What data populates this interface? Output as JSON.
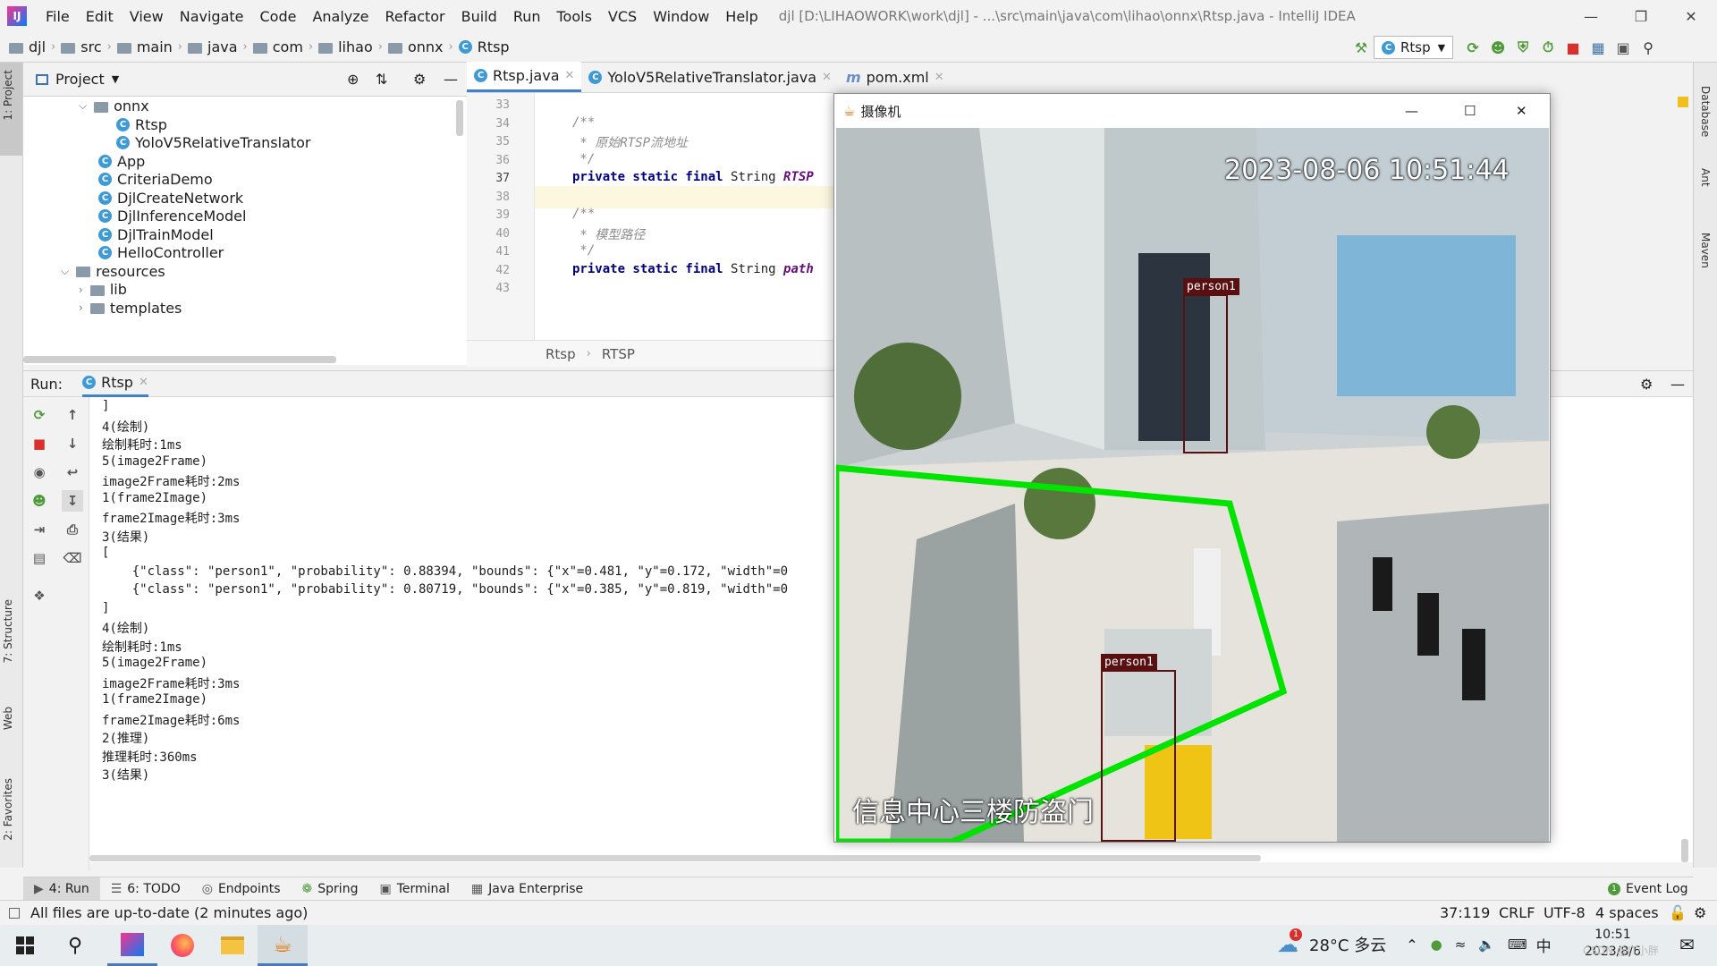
{
  "app": {
    "logo": "IJ",
    "title": "djl [D:\\LIHAOWORK\\work\\djl] - ...\\src\\main\\java\\com\\lihao\\onnx\\Rtsp.java - IntelliJ IDEA"
  },
  "menu": [
    "File",
    "Edit",
    "View",
    "Navigate",
    "Code",
    "Analyze",
    "Refactor",
    "Build",
    "Run",
    "Tools",
    "VCS",
    "Window",
    "Help"
  ],
  "breadcrumbs": [
    "djl",
    "src",
    "main",
    "java",
    "com",
    "lihao",
    "onnx",
    "Rtsp"
  ],
  "run_config": "Rtsp",
  "left_strip": {
    "project": "1: Project",
    "structure": "7: Structure",
    "web": "Web",
    "favorites": "2: Favorites"
  },
  "right_strip": {
    "database": "Database",
    "ant": "Ant",
    "maven": "Maven"
  },
  "project_panel": {
    "title": "Project",
    "tree": [
      {
        "label": "onnx",
        "kind": "folder",
        "indent": 3,
        "expanded": true
      },
      {
        "label": "Rtsp",
        "kind": "class",
        "indent": 5
      },
      {
        "label": "YoloV5RelativeTranslator",
        "kind": "class",
        "indent": 5
      },
      {
        "label": "App",
        "kind": "class",
        "indent": 4
      },
      {
        "label": "CriteriaDemo",
        "kind": "class",
        "indent": 4
      },
      {
        "label": "DjlCreateNetwork",
        "kind": "class",
        "indent": 4
      },
      {
        "label": "DjlInferenceModel",
        "kind": "class",
        "indent": 4
      },
      {
        "label": "DjlTrainModel",
        "kind": "class",
        "indent": 4
      },
      {
        "label": "HelloController",
        "kind": "class",
        "indent": 4
      },
      {
        "label": "resources",
        "kind": "folder",
        "indent": 2,
        "expanded": true
      },
      {
        "label": "lib",
        "kind": "folder",
        "indent": 3,
        "expanded": false
      },
      {
        "label": "templates",
        "kind": "folder",
        "indent": 3,
        "expanded": false
      }
    ]
  },
  "editor_tabs": [
    {
      "label": "Rtsp.java",
      "active": true
    },
    {
      "label": "YoloV5RelativeTranslator.java",
      "active": false
    },
    {
      "label": "pom.xml",
      "active": false
    }
  ],
  "editor": {
    "line_numbers": [
      "33",
      "34",
      "35",
      "36",
      "37",
      "38",
      "39",
      "40",
      "41",
      "42",
      "43"
    ],
    "current_line": "37",
    "lines": [
      {
        "n": "33",
        "segs": []
      },
      {
        "n": "34",
        "segs": [
          {
            "c": "cmt",
            "t": "/**"
          }
        ]
      },
      {
        "n": "35",
        "segs": [
          {
            "c": "cmt",
            "t": " * 原始RTSP流地址"
          }
        ]
      },
      {
        "n": "36",
        "segs": [
          {
            "c": "cmt",
            "t": " */"
          }
        ]
      },
      {
        "n": "37",
        "segs": [
          {
            "c": "kw",
            "t": "private static final "
          },
          {
            "c": "",
            "t": "String "
          },
          {
            "c": "fld",
            "t": "RTSP"
          }
        ]
      },
      {
        "n": "38",
        "segs": []
      },
      {
        "n": "39",
        "segs": [
          {
            "c": "cmt",
            "t": "/**"
          }
        ]
      },
      {
        "n": "40",
        "segs": [
          {
            "c": "cmt",
            "t": " * 模型路径"
          }
        ]
      },
      {
        "n": "41",
        "segs": [
          {
            "c": "cmt",
            "t": " */"
          }
        ]
      },
      {
        "n": "42",
        "segs": [
          {
            "c": "kw",
            "t": "private static final "
          },
          {
            "c": "",
            "t": "String "
          },
          {
            "c": "fld",
            "t": "path"
          }
        ]
      },
      {
        "n": "43",
        "segs": []
      }
    ],
    "breadcrumb": [
      "Rtsp",
      "RTSP"
    ]
  },
  "run_panel": {
    "label": "Run:",
    "tab": "Rtsp"
  },
  "console": [
    "]",
    "4(绘制)",
    "绘制耗时:1ms",
    "5(image2Frame)",
    "image2Frame耗时:2ms",
    "1(frame2Image)",
    "frame2Image耗时:3ms",
    "3(结果)",
    "[",
    "    {\"class\": \"person1\", \"probability\": 0.88394, \"bounds\": {\"x\"=0.481, \"y\"=0.172, \"width\"=0",
    "    {\"class\": \"person1\", \"probability\": 0.80719, \"bounds\": {\"x\"=0.385, \"y\"=0.819, \"width\"=0",
    "]",
    "4(绘制)",
    "绘制耗时:1ms",
    "5(image2Frame)",
    "image2Frame耗时:3ms",
    "1(frame2Image)",
    "frame2Image耗时:6ms",
    "2(推理)",
    "推理耗时:360ms",
    "3(结果)"
  ],
  "bottom_tabs": [
    "4: Run",
    "6: TODO",
    "Endpoints",
    "Spring",
    "Terminal",
    "Java Enterprise"
  ],
  "event_log": "Event Log",
  "status": {
    "message": "All files are up-to-date (2 minutes ago)",
    "position": "37:119",
    "line_sep": "CRLF",
    "encoding": "UTF-8",
    "indent": "4 spaces"
  },
  "camera": {
    "title": "摄像机",
    "timestamp": "2023-08-06 10:51:44",
    "caption": "信息中心三楼防盗门",
    "labels": [
      "person1",
      "person1"
    ]
  },
  "taskbar": {
    "weather": "28°C 多云",
    "ime": "中",
    "time": "10:51",
    "date": "2023/8/6",
    "watermark": "CSDN @IT小胖",
    "badge": "1"
  }
}
